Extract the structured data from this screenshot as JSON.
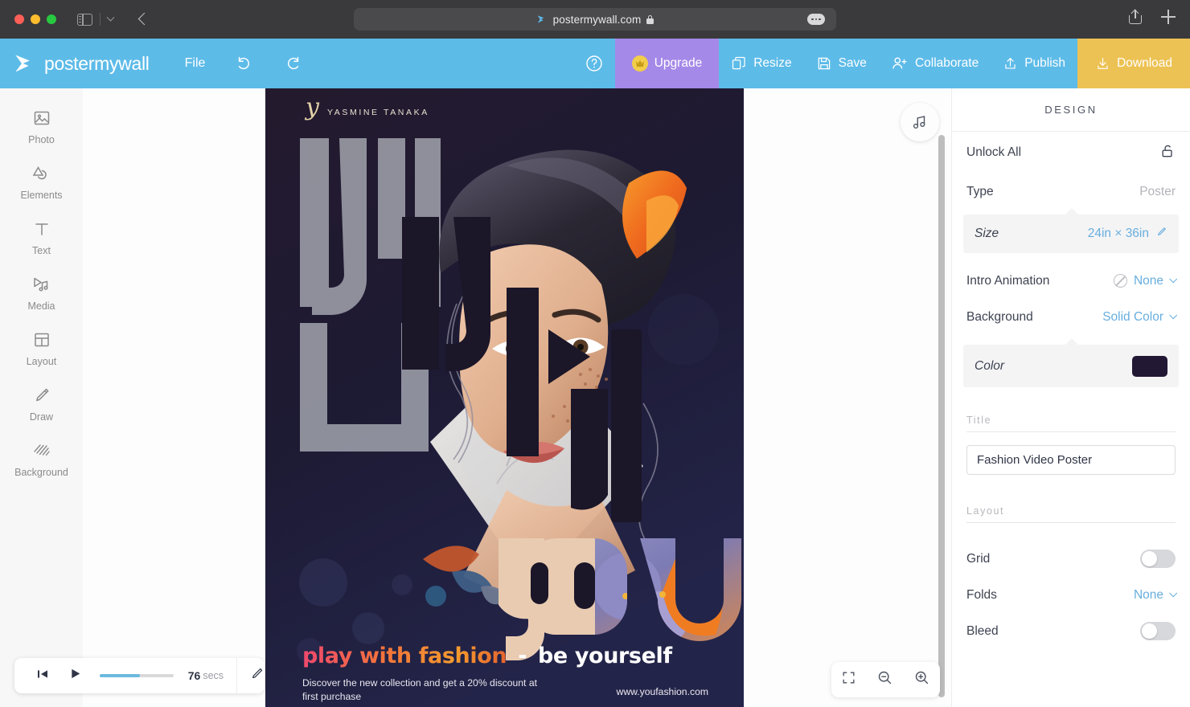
{
  "browser": {
    "url": "postermywall.com",
    "icons": {
      "sidebar": "sidebar-toggle-icon",
      "back": "back-arrow-icon",
      "lock": "lock-icon",
      "more": "more-options-icon",
      "share": "share-icon",
      "new_tab": "plus-icon"
    }
  },
  "toolbar": {
    "brand": "postermywall",
    "file": "File",
    "undo": "undo-icon",
    "redo": "redo-icon",
    "help": "?",
    "upgrade": "Upgrade",
    "resize": "Resize",
    "save": "Save",
    "collaborate": "Collaborate",
    "publish": "Publish",
    "download": "Download",
    "colors": {
      "bar": "#5dbbe8",
      "upgrade": "#a589e8",
      "download": "#edc254"
    }
  },
  "rail": {
    "items": [
      {
        "label": "Photo",
        "icon": "photo-icon"
      },
      {
        "label": "Elements",
        "icon": "elements-icon"
      },
      {
        "label": "Text",
        "icon": "text-icon"
      },
      {
        "label": "Media",
        "icon": "media-icon"
      },
      {
        "label": "Layout",
        "icon": "layout-icon"
      },
      {
        "label": "Draw",
        "icon": "draw-icon"
      },
      {
        "label": "Background",
        "icon": "background-icon"
      }
    ]
  },
  "canvas": {
    "poster": {
      "designer_script": "y",
      "designer_name": "YASMINE TANAKA",
      "headline_overlay": "YOU",
      "tagline_colored": "play with fashion",
      "tagline_dash": "-",
      "tagline_white": "be yourself",
      "subtext": "Discover the new collection and get a 20% discount at first purchase",
      "website": "www.youfashion.com",
      "background_color": "#221833"
    },
    "music_button": "music-note-icon",
    "zoom_controls": {
      "fit": "fit-to-screen-icon",
      "zoom_out": "zoom-out-icon",
      "zoom_in": "zoom-in-icon"
    }
  },
  "player": {
    "skip_start": "skip-to-start-icon",
    "play": "play-icon",
    "progress_percent": 55,
    "duration_value": "76",
    "duration_unit": "secs",
    "edit": "edit-pencil-icon"
  },
  "panel": {
    "title": "DESIGN",
    "unlock_all": {
      "label": "Unlock All",
      "icon": "unlock-icon"
    },
    "type": {
      "label": "Type",
      "value": "Poster"
    },
    "size": {
      "label": "Size",
      "value": "24in × 36in",
      "icon": "edit-pencil-icon"
    },
    "intro_animation": {
      "label": "Intro Animation",
      "value": "None",
      "icon": "no-animation-icon"
    },
    "background": {
      "label": "Background",
      "value": "Solid Color"
    },
    "color": {
      "label": "Color",
      "value": "#221833"
    },
    "title_section": {
      "label": "Title",
      "value": "Fashion Video Poster"
    },
    "layout_section": {
      "label": "Layout"
    },
    "grid": {
      "label": "Grid",
      "on": false
    },
    "folds": {
      "label": "Folds",
      "value": "None"
    },
    "bleed": {
      "label": "Bleed",
      "on": false
    }
  }
}
